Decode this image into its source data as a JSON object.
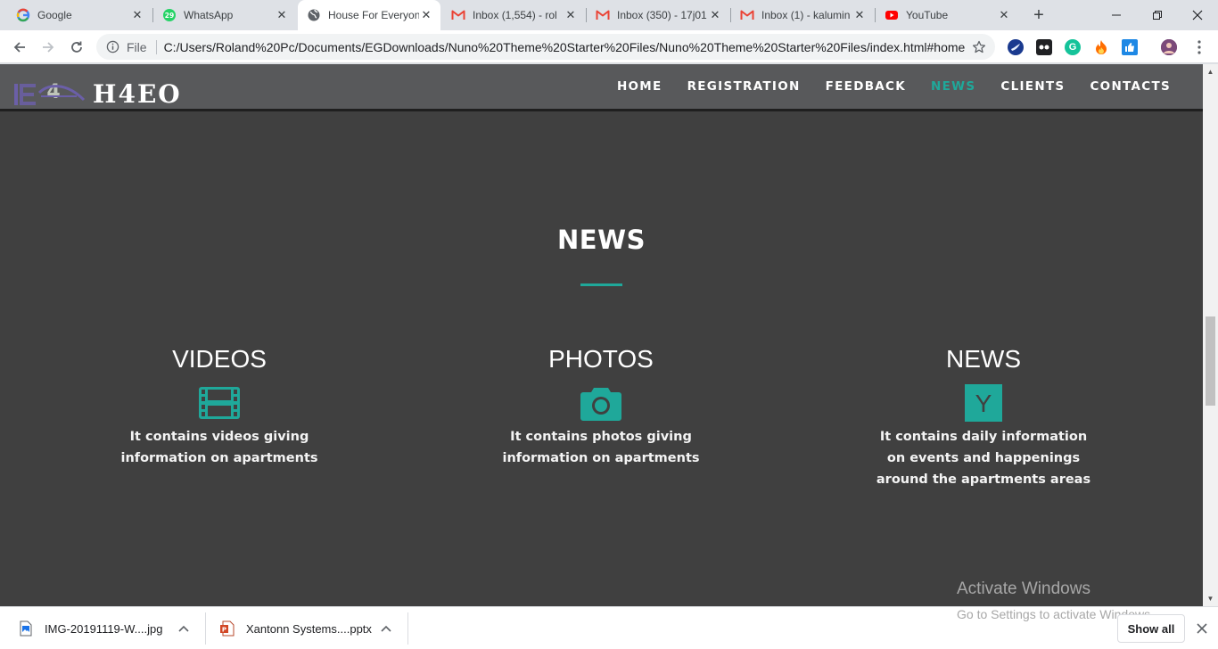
{
  "browser": {
    "tabs": [
      {
        "title": "Google",
        "icon": "google-icon"
      },
      {
        "title": "WhatsApp",
        "icon": "whatsapp-icon",
        "badge": "29"
      },
      {
        "title": "House For Everyone",
        "icon": "globe-icon",
        "active": true
      },
      {
        "title": "Inbox (1,554) - rol",
        "icon": "gmail-icon"
      },
      {
        "title": "Inbox (350) - 17j01",
        "icon": "gmail-icon"
      },
      {
        "title": "Inbox (1) - kalumin",
        "icon": "gmail-icon"
      },
      {
        "title": "YouTube",
        "icon": "youtube-icon"
      }
    ],
    "omnibox": {
      "scheme": "File",
      "url": "C:/Users/Roland%20Pc/Documents/EGDownloads/Nuno%20Theme%20Starter%20Files/Nuno%20Theme%20Starter%20Files/index.html#home"
    }
  },
  "site": {
    "logo_text": "H4EO",
    "logo_mark": "4",
    "nav": [
      {
        "label": "HOME",
        "active": false
      },
      {
        "label": "REGISTRATION",
        "active": false
      },
      {
        "label": "FEEDBACK",
        "active": false
      },
      {
        "label": "NEWS",
        "active": true
      },
      {
        "label": "CLIENTS",
        "active": false
      },
      {
        "label": "CONTACTS",
        "active": false
      }
    ],
    "section_title": "NEWS",
    "features": [
      {
        "title": "VIDEOS",
        "icon": "film-icon",
        "desc_lines": [
          "It contains videos giving",
          "information on apartments"
        ]
      },
      {
        "title": "PHOTOS",
        "icon": "camera-icon",
        "desc_lines": [
          "It contains photos giving",
          "information on apartments"
        ]
      },
      {
        "title": "NEWS",
        "icon": "hacker-news-icon",
        "icon_letter": "Y",
        "desc_lines": [
          "It contains daily information",
          "on events and happenings",
          "around the apartments areas"
        ]
      }
    ],
    "accent_color": "#1fa89a"
  },
  "watermark": {
    "line1": "Activate Windows",
    "line2": "Go to Settings to activate Windows."
  },
  "downloads": {
    "items": [
      {
        "name": "IMG-20191119-W....jpg",
        "icon": "image-file-icon"
      },
      {
        "name": "Xantonn Systems....pptx",
        "icon": "powerpoint-file-icon"
      }
    ],
    "show_all": "Show all"
  }
}
